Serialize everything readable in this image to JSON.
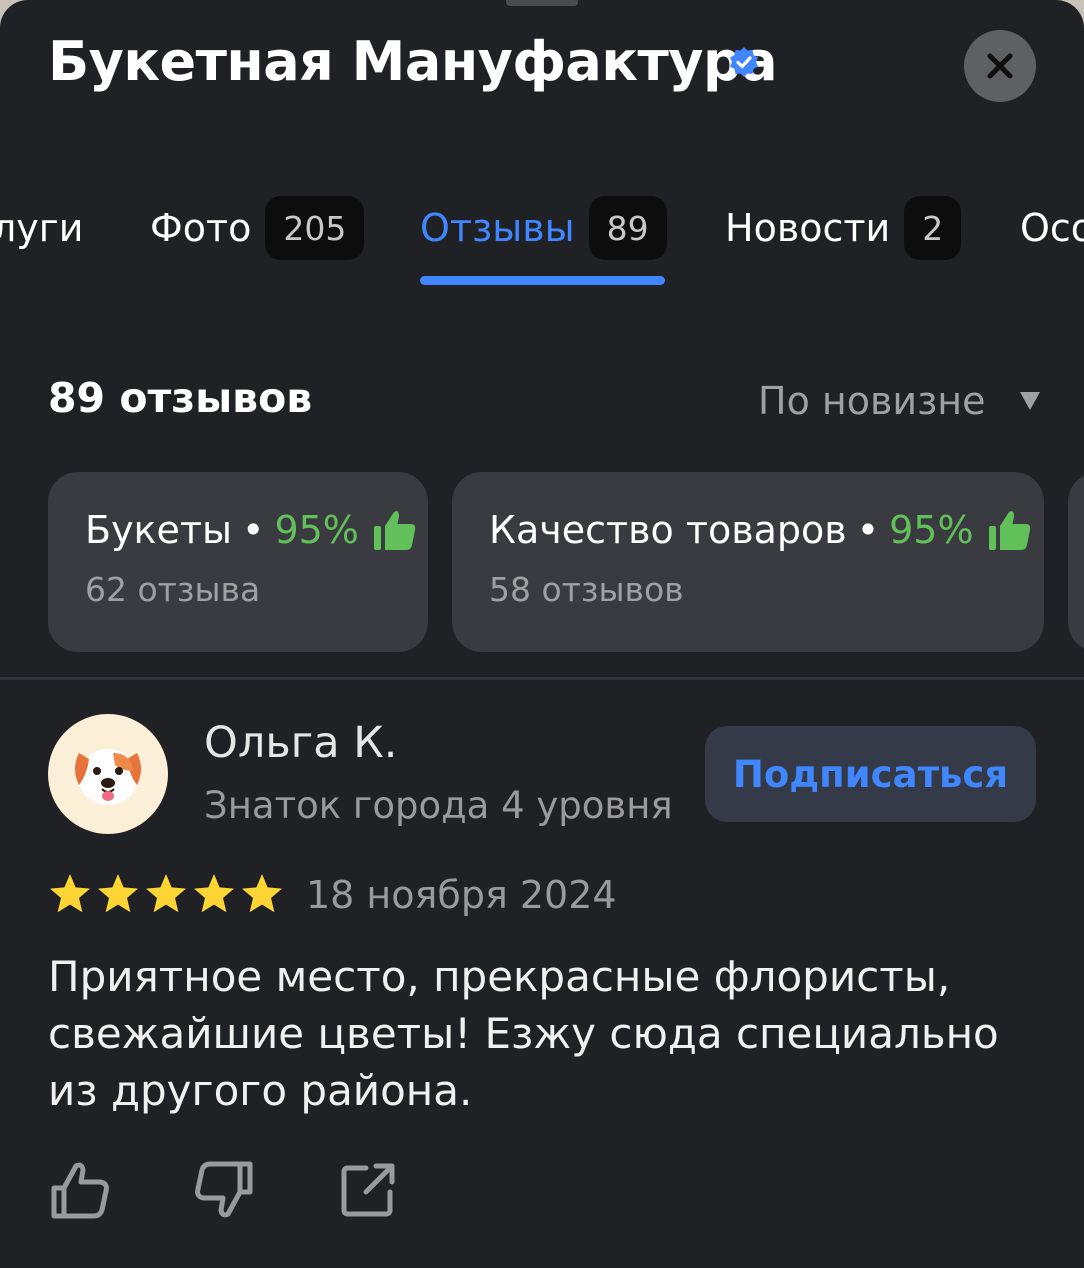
{
  "header": {
    "title": "Букетная Мануфактура",
    "verified_icon": "verified-check-icon",
    "close_icon": "close-icon"
  },
  "tabs": [
    {
      "label": "луги",
      "count": null
    },
    {
      "label": "Фото",
      "count": "205"
    },
    {
      "label": "Отзывы",
      "count": "89",
      "active": true
    },
    {
      "label": "Новости",
      "count": "2"
    },
    {
      "label": "Осо",
      "count": null
    }
  ],
  "reviews": {
    "total_label": "89 отзывов",
    "sort_label": "По новизне"
  },
  "aspects": [
    {
      "name": "Букеты",
      "dot": "•",
      "percent": "95%",
      "count_label": "62 отзыва"
    },
    {
      "name": "Качество товаров",
      "dot": "•",
      "percent": "95%",
      "count_label": "58 отзывов"
    }
  ],
  "review": {
    "author": "Ольга К.",
    "level": "Знаток города 4 уровня",
    "subscribe_label": "Подписаться",
    "rating": 5,
    "date": "18 ноября 2024",
    "text": "Приятное место, прекрасные флористы, свежайшие цветы! Езжу сюда специально из другого района.",
    "avatar_icon": "dog-emoji-avatar",
    "actions": [
      "like-icon",
      "dislike-icon",
      "share-icon"
    ]
  },
  "colors": {
    "background": "#202124",
    "accent": "#3f86ff",
    "positive": "#62c05a",
    "star": "#fcd535"
  }
}
